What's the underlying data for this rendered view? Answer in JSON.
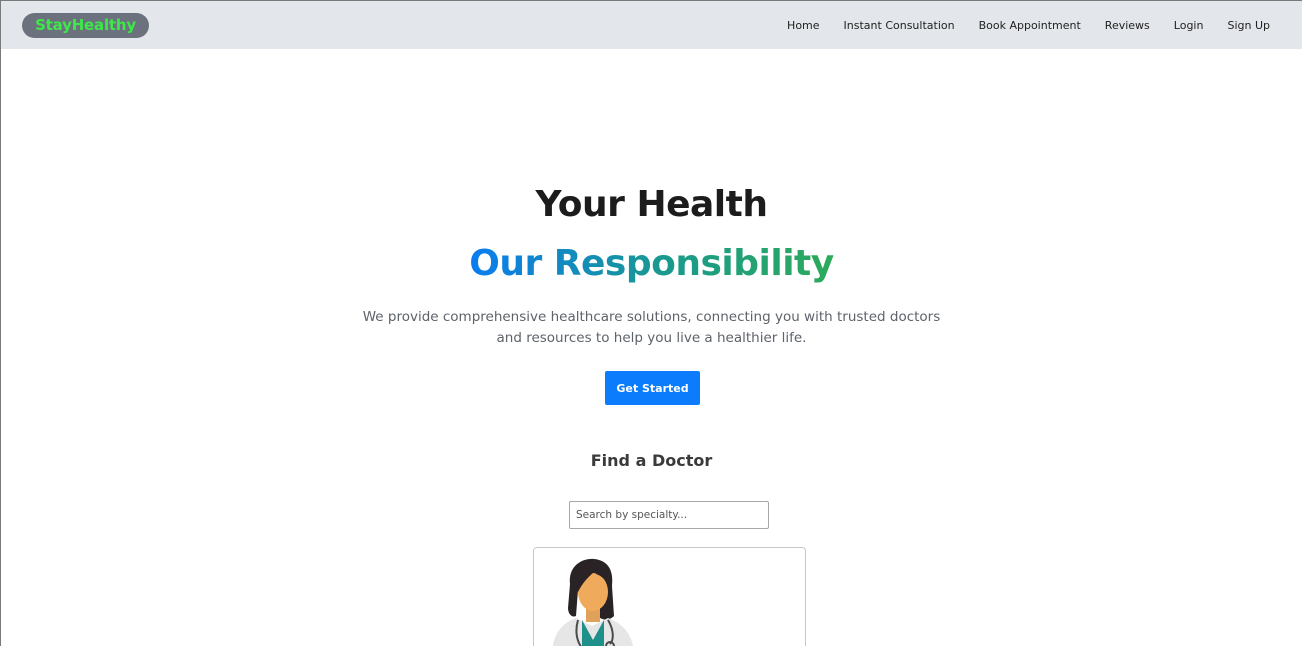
{
  "navbar": {
    "logo": "StayHealthy",
    "links": [
      "Home",
      "Instant Consultation",
      "Book Appointment",
      "Reviews",
      "Login",
      "Sign Up"
    ]
  },
  "hero": {
    "title": "Your Health",
    "subtitle": "Our Responsibility",
    "description": "We provide comprehensive healthcare solutions, connecting you with trusted doctors and resources to help you live a healthier life.",
    "cta": "Get Started"
  },
  "find_doctor": {
    "title": "Find a Doctor",
    "search_placeholder": "Search by specialty..."
  },
  "colors": {
    "navbar_bg": "#e3e6ea",
    "logo_bg": "#6c727d",
    "logo_text": "#3de84a",
    "accent": "#0b7cfb",
    "gradient_start": "#0a7cf0",
    "gradient_end": "#2daa5a"
  },
  "icons": [
    "doctor-avatar-icon"
  ]
}
